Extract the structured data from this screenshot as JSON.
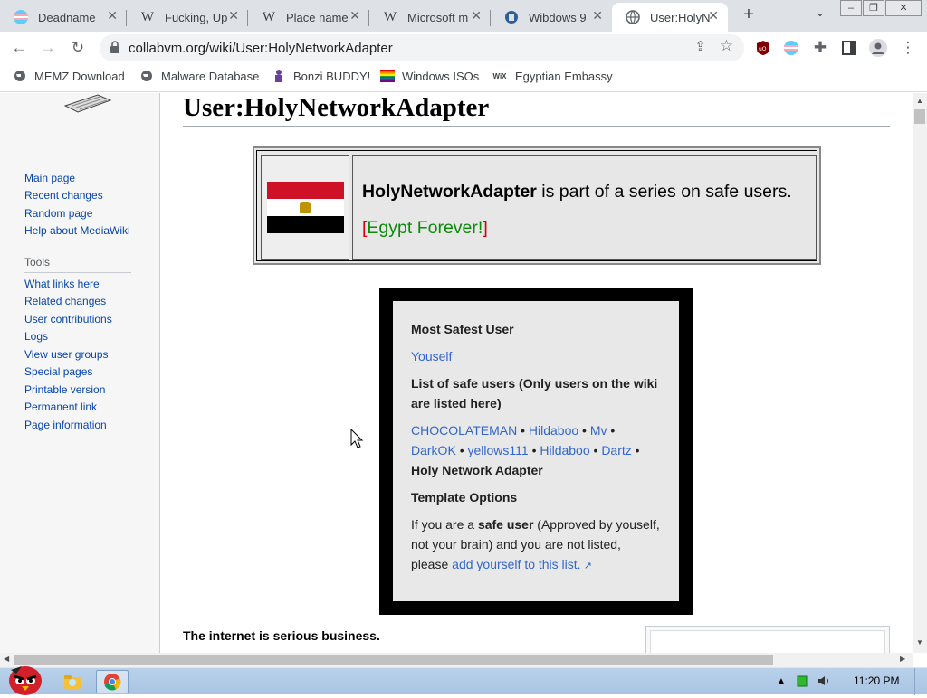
{
  "browser": {
    "tabs": [
      {
        "title": "Deadname",
        "favicon": "trans-flag-icon"
      },
      {
        "title": "Fucking, Up",
        "favicon": "wikipedia-icon"
      },
      {
        "title": "Place name",
        "favicon": "wikipedia-icon"
      },
      {
        "title": "Microsoft m",
        "favicon": "wikipedia-icon"
      },
      {
        "title": "Wibdows 9",
        "favicon": "site-icon"
      },
      {
        "title": "User:HolyN",
        "favicon": "globe-icon",
        "active": true
      }
    ],
    "url": "collabvm.org/wiki/User:HolyNetworkAdapter",
    "bookmarks": [
      {
        "label": "MEMZ Download",
        "icon": "globe-icon"
      },
      {
        "label": "Malware Database",
        "icon": "globe-icon"
      },
      {
        "label": "Bonzi BUDDY!",
        "icon": "bonzi-icon"
      },
      {
        "label": "Windows ISOs",
        "icon": "rainbow-flag-icon"
      },
      {
        "label": "Egyptian Embassy",
        "icon": "wix-icon"
      }
    ],
    "wix_glyph": "WiX"
  },
  "sidebar": {
    "nav": [
      "Main page",
      "Recent changes",
      "Random page",
      "Help about MediaWiki"
    ],
    "tools_heading": "Tools",
    "tools": [
      "What links here",
      "Related changes",
      "User contributions",
      "Logs",
      "View user groups",
      "Special pages",
      "Printable version",
      "Permanent link",
      "Page information"
    ]
  },
  "page": {
    "title": "User:HolyNetworkAdapter",
    "userbox": {
      "username": "HolyNetworkAdapter",
      "text": " is part of a series on safe users.",
      "bracket_open": "[",
      "egypt": "Egypt Forever!",
      "bracket_close": "]"
    },
    "safe_box": {
      "heading1": "Most Safest User",
      "link1": "Youself",
      "heading2": "List of safe users (Only users on the wiki are listed here)",
      "users": [
        "CHOCOLATEMAN",
        "Hildaboo",
        "Mv",
        "DarkOK",
        "yellows111",
        "Hildaboo",
        "Dartz"
      ],
      "bullet": "•",
      "last_user": "Holy Network Adapter",
      "heading3": "Template Options",
      "opt_pre": "If you are a ",
      "opt_bold": "safe user",
      "opt_mid": " (Approved by youself, not your brain) and you are not listed, please ",
      "opt_link": "add yourself to this list."
    },
    "bottom_text": "The internet is serious business."
  },
  "taskbar": {
    "clock": "11:20 PM"
  },
  "colors": {
    "link": "#0645ad",
    "flag_red": "#ce1126",
    "egypt_green": "#0a8a0a"
  }
}
